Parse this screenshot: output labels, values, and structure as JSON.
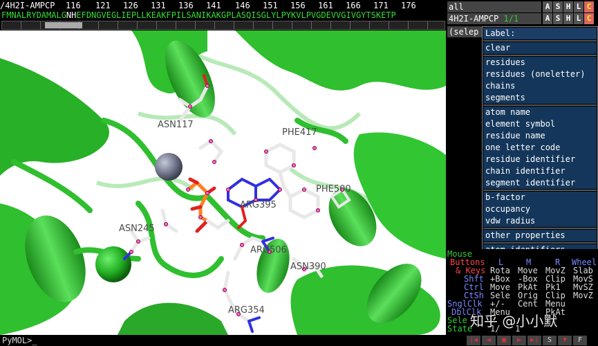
{
  "sequence": {
    "object_name": "/4H2I-AMPCP",
    "numbers": [
      "116",
      "121",
      "126",
      "131",
      "136",
      "141",
      "146",
      "151",
      "156",
      "161",
      "166",
      "171",
      "176"
    ],
    "letters_before": "FMNALRYDAMALG",
    "letters_selected": "NH",
    "letters_after": "EFDNGVEGLIEPLLKEAKFPILSANIKAKGPLASQISGLYLPYKVLPVGDEVVGIVGYTSKETP"
  },
  "viewport": {
    "residue_labels": [
      "ASN117",
      "PHE417",
      "PHE500",
      "ARG395",
      "ASN245",
      "ARG506",
      "ASN390",
      "ARG354"
    ],
    "colors": {
      "cartoon": "#2fbf2f",
      "carbon": "#e8e8e8",
      "nitrogen": "#3030e0",
      "oxygen": "#e02020",
      "phosphorus": "#ff8020",
      "zinc": "#7a7f95",
      "background": "#ffffff"
    }
  },
  "command_line": {
    "prompt": "PyMOL>_"
  },
  "objects": [
    {
      "name": "all",
      "state": ""
    },
    {
      "name": "4H2I-AMPCP",
      "state": "1/1"
    }
  ],
  "object_buttons": [
    "A",
    "S",
    "H",
    "L",
    "C"
  ],
  "selection": {
    "name": "(selep"
  },
  "label_menu": {
    "title": "Label:",
    "groups": [
      [
        "clear"
      ],
      [
        "residues",
        "residues (oneletter)",
        "chains",
        "segments"
      ],
      [
        "atom name",
        "element symbol",
        "residue name",
        "one letter code",
        "residue identifier",
        "chain identifier",
        "segment identifier"
      ],
      [
        "b-factor",
        "occupancy",
        "vdw radius"
      ],
      [
        "other properties"
      ],
      [
        "atom identifiers"
      ]
    ]
  },
  "mouse_panel": {
    "title": "Mouse",
    "buttons_label": "Buttons",
    "columns": [
      "L",
      "M",
      "R",
      "Wheel"
    ],
    "rows": [
      {
        "key": "& Keys",
        "values": [
          "Rota",
          "Move",
          "MovZ",
          "Slab"
        ]
      },
      {
        "key": "Shft",
        "values": [
          "+Box",
          "-Box",
          "Clip",
          "MovS"
        ]
      },
      {
        "key": "Ctrl",
        "values": [
          "Move",
          "PkAt",
          "Pk1",
          "MvSZ"
        ]
      },
      {
        "key": "CtSh",
        "values": [
          "Sele",
          "Orig",
          "Clip",
          "MovZ"
        ]
      },
      {
        "key": "SnglClk",
        "values": [
          "+/-",
          "Cent",
          "Menu",
          ""
        ]
      },
      {
        "key": "DblClk",
        "values": [
          "Menu",
          "",
          "PkAt",
          ""
        ]
      }
    ],
    "selecting_prefix": "Sele",
    "state_prefix": "State",
    "state_value": "1/   1"
  },
  "watermark": "知乎 @小小默",
  "movie_buttons": [
    "|◀",
    "◀",
    "■",
    "▶",
    "▶|",
    "S",
    "▼",
    "F"
  ]
}
